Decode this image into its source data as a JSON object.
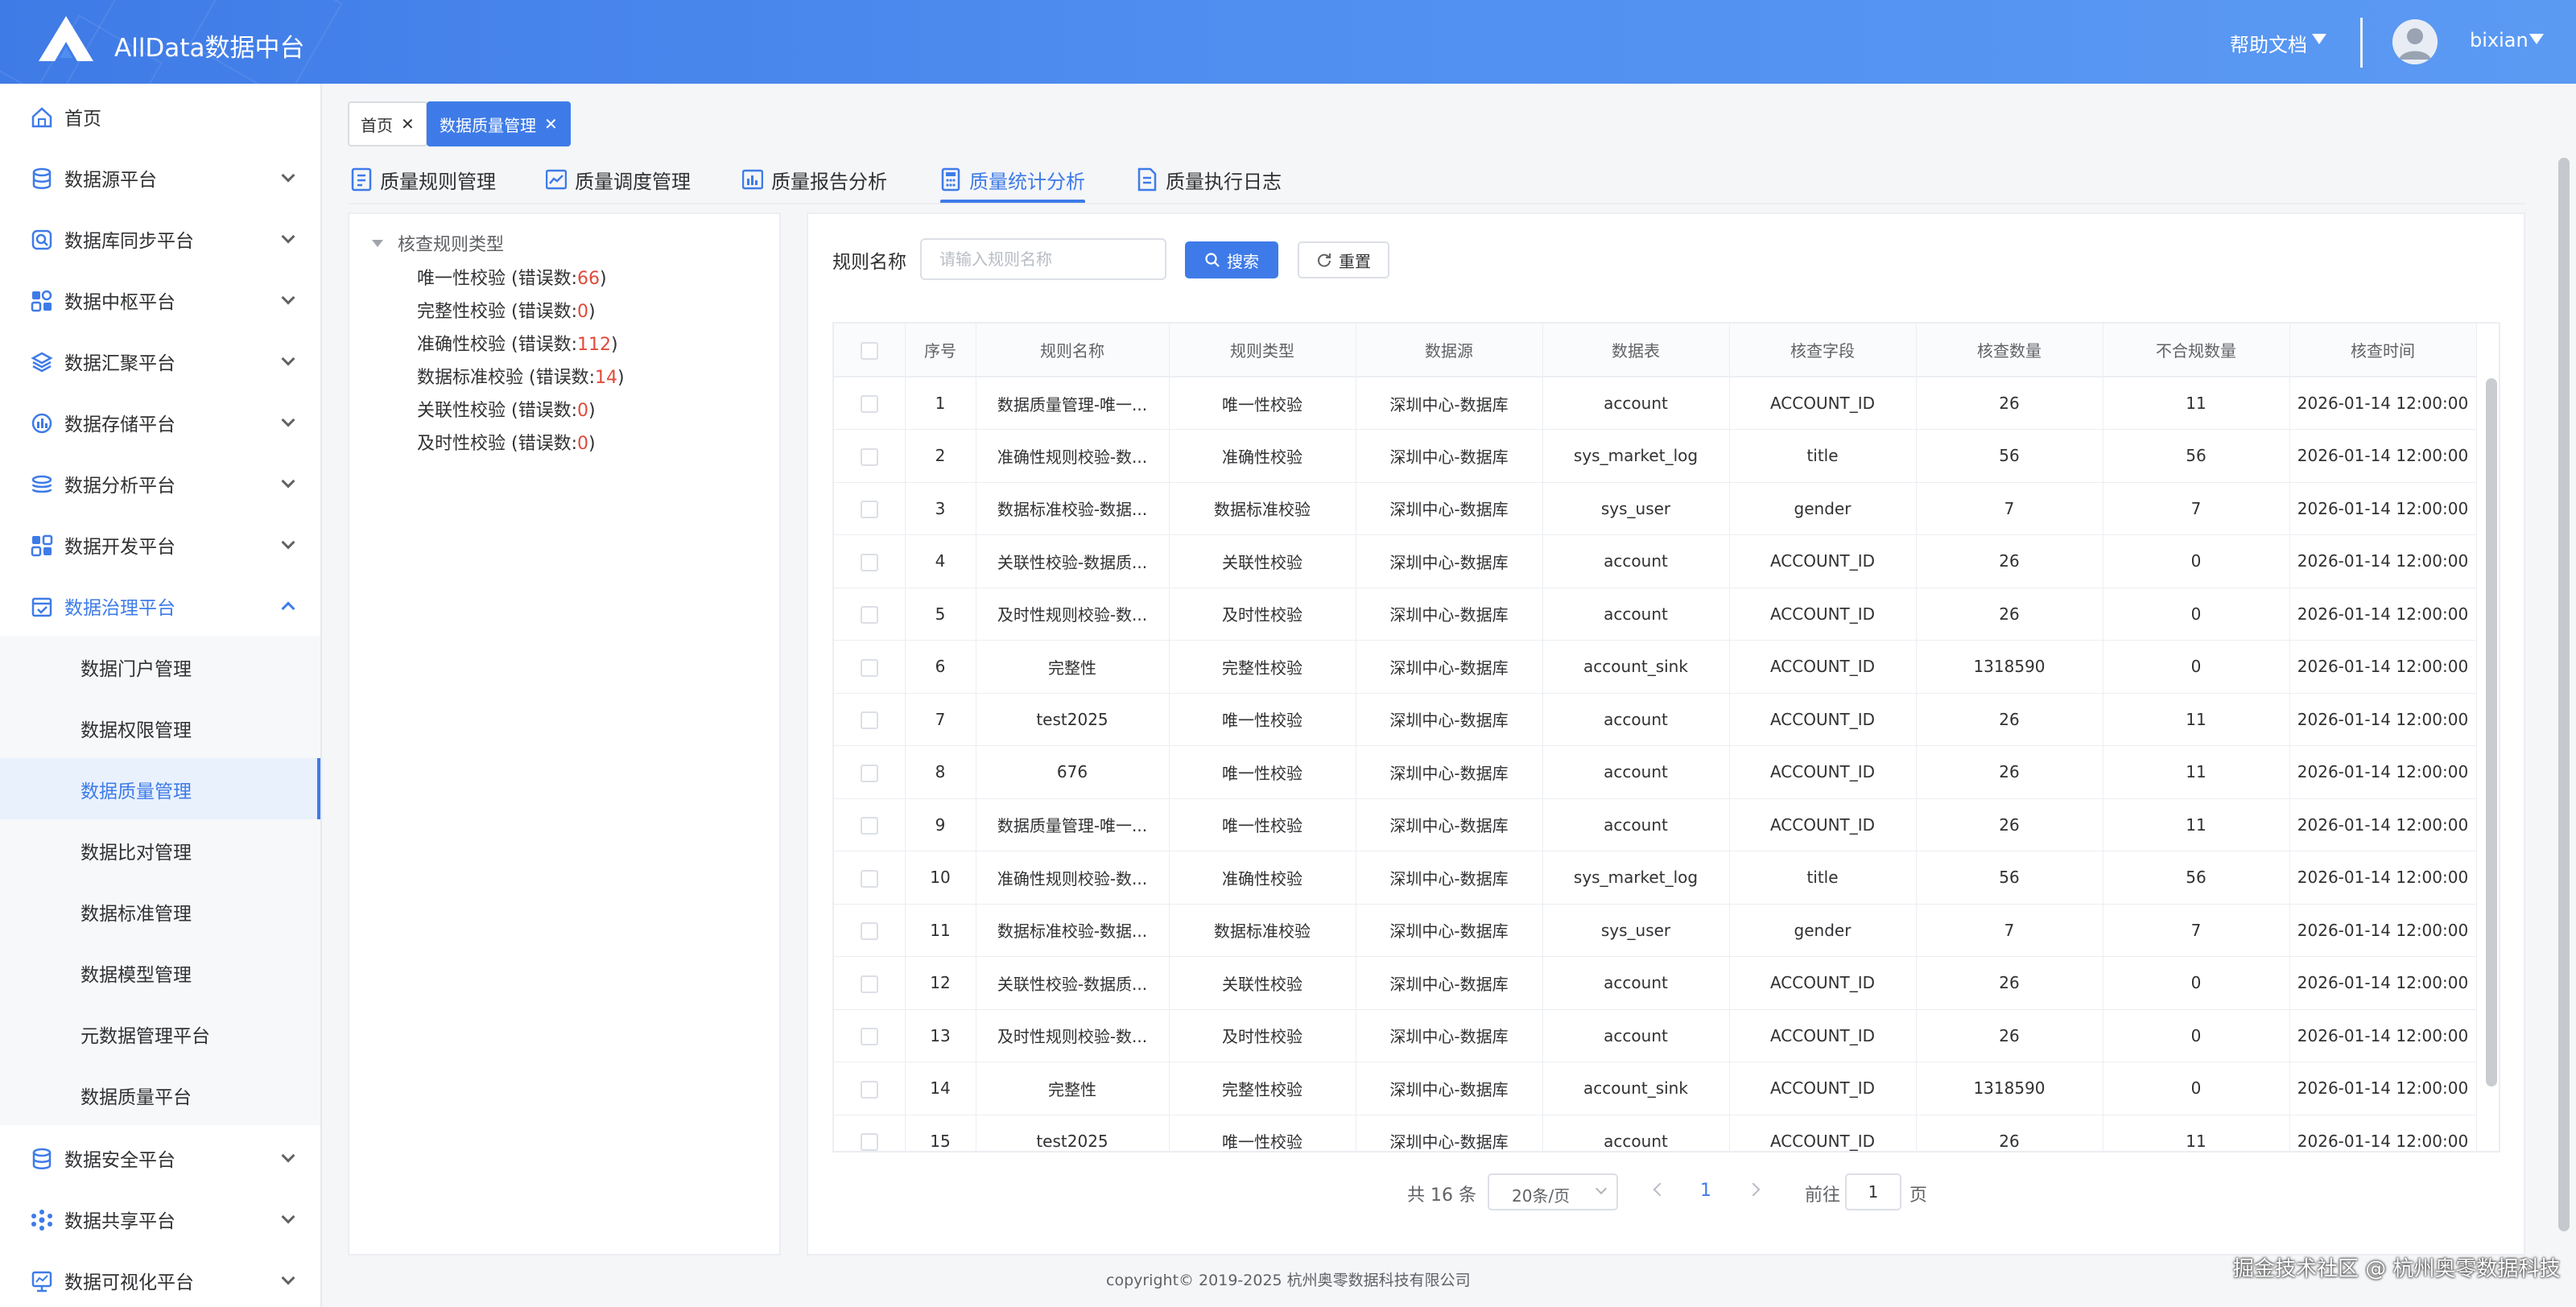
{
  "app": {
    "title": "AllData数据中台"
  },
  "header": {
    "help_label": "帮助文档",
    "username": "bixian"
  },
  "sidebar": {
    "items": [
      {
        "label": "首页",
        "icon": "home-icon",
        "expandable": false
      },
      {
        "label": "数据源平台",
        "icon": "database-icon",
        "expandable": true
      },
      {
        "label": "数据库同步平台",
        "icon": "sync-icon",
        "expandable": true
      },
      {
        "label": "数据中枢平台",
        "icon": "hub-icon",
        "expandable": true
      },
      {
        "label": "数据汇聚平台",
        "icon": "layers-icon",
        "expandable": true
      },
      {
        "label": "数据存储平台",
        "icon": "storage-icon",
        "expandable": true
      },
      {
        "label": "数据分析平台",
        "icon": "analysis-icon",
        "expandable": true
      },
      {
        "label": "数据开发平台",
        "icon": "dev-icon",
        "expandable": true
      },
      {
        "label": "数据治理平台",
        "icon": "governance-icon",
        "expandable": true,
        "expanded": true
      },
      {
        "label": "数据安全平台",
        "icon": "security-icon",
        "expandable": true
      },
      {
        "label": "数据共享平台",
        "icon": "share-icon",
        "expandable": true
      },
      {
        "label": "数据可视化平台",
        "icon": "chart-icon",
        "expandable": true
      }
    ],
    "submenu": [
      {
        "label": "数据门户管理"
      },
      {
        "label": "数据权限管理"
      },
      {
        "label": "数据质量管理",
        "selected": true
      },
      {
        "label": "数据比对管理"
      },
      {
        "label": "数据标准管理"
      },
      {
        "label": "数据模型管理"
      },
      {
        "label": "元数据管理平台"
      },
      {
        "label": "数据质量平台"
      }
    ]
  },
  "tags": [
    {
      "label": "首页",
      "active": false
    },
    {
      "label": "数据质量管理",
      "active": true
    }
  ],
  "subtabs": [
    {
      "label": "质量规则管理"
    },
    {
      "label": "质量调度管理"
    },
    {
      "label": "质量报告分析"
    },
    {
      "label": "质量统计分析",
      "active": true
    },
    {
      "label": "质量执行日志"
    }
  ],
  "tree": {
    "root": "核查规则类型",
    "nodes": [
      {
        "name": "唯一性校验",
        "prefix": " (错误数:",
        "count": "66",
        "suffix": ")"
      },
      {
        "name": "完整性校验",
        "prefix": " (错误数:",
        "count": "0",
        "suffix": ")"
      },
      {
        "name": "准确性校验",
        "prefix": " (错误数:",
        "count": "112",
        "suffix": ")"
      },
      {
        "name": "数据标准校验",
        "prefix": " (错误数:",
        "count": "14",
        "suffix": ")"
      },
      {
        "name": "关联性校验",
        "prefix": " (错误数:",
        "count": "0",
        "suffix": ")"
      },
      {
        "name": "及时性校验",
        "prefix": " (错误数:",
        "count": "0",
        "suffix": ")"
      }
    ]
  },
  "search": {
    "label": "规则名称",
    "placeholder": "请输入规则名称",
    "search_button": "搜索",
    "reset_button": "重置"
  },
  "table": {
    "headers": [
      "序号",
      "规则名称",
      "规则类型",
      "数据源",
      "数据表",
      "核查字段",
      "核查数量",
      "不合规数量",
      "核查时间"
    ],
    "rows": [
      [
        "1",
        "数据质量管理-唯一...",
        "唯一性校验",
        "深圳中心-数据库",
        "account",
        "ACCOUNT_ID",
        "26",
        "11",
        "2026-01-14 12:00:00"
      ],
      [
        "2",
        "准确性规则校验-数...",
        "准确性校验",
        "深圳中心-数据库",
        "sys_market_log",
        "title",
        "56",
        "56",
        "2026-01-14 12:00:00"
      ],
      [
        "3",
        "数据标准校验-数据...",
        "数据标准校验",
        "深圳中心-数据库",
        "sys_user",
        "gender",
        "7",
        "7",
        "2026-01-14 12:00:00"
      ],
      [
        "4",
        "关联性校验-数据质...",
        "关联性校验",
        "深圳中心-数据库",
        "account",
        "ACCOUNT_ID",
        "26",
        "0",
        "2026-01-14 12:00:00"
      ],
      [
        "5",
        "及时性规则校验-数...",
        "及时性校验",
        "深圳中心-数据库",
        "account",
        "ACCOUNT_ID",
        "26",
        "0",
        "2026-01-14 12:00:00"
      ],
      [
        "6",
        "完整性",
        "完整性校验",
        "深圳中心-数据库",
        "account_sink",
        "ACCOUNT_ID",
        "1318590",
        "0",
        "2026-01-14 12:00:00"
      ],
      [
        "7",
        "test2025",
        "唯一性校验",
        "深圳中心-数据库",
        "account",
        "ACCOUNT_ID",
        "26",
        "11",
        "2026-01-14 12:00:00"
      ],
      [
        "8",
        "676",
        "唯一性校验",
        "深圳中心-数据库",
        "account",
        "ACCOUNT_ID",
        "26",
        "11",
        "2026-01-14 12:00:00"
      ],
      [
        "9",
        "数据质量管理-唯一...",
        "唯一性校验",
        "深圳中心-数据库",
        "account",
        "ACCOUNT_ID",
        "26",
        "11",
        "2026-01-14 12:00:00"
      ],
      [
        "10",
        "准确性规则校验-数...",
        "准确性校验",
        "深圳中心-数据库",
        "sys_market_log",
        "title",
        "56",
        "56",
        "2026-01-14 12:00:00"
      ],
      [
        "11",
        "数据标准校验-数据...",
        "数据标准校验",
        "深圳中心-数据库",
        "sys_user",
        "gender",
        "7",
        "7",
        "2026-01-14 12:00:00"
      ],
      [
        "12",
        "关联性校验-数据质...",
        "关联性校验",
        "深圳中心-数据库",
        "account",
        "ACCOUNT_ID",
        "26",
        "0",
        "2026-01-14 12:00:00"
      ],
      [
        "13",
        "及时性规则校验-数...",
        "及时性校验",
        "深圳中心-数据库",
        "account",
        "ACCOUNT_ID",
        "26",
        "0",
        "2026-01-14 12:00:00"
      ],
      [
        "14",
        "完整性",
        "完整性校验",
        "深圳中心-数据库",
        "account_sink",
        "ACCOUNT_ID",
        "1318590",
        "0",
        "2026-01-14 12:00:00"
      ],
      [
        "15",
        "test2025",
        "唯一性校验",
        "深圳中心-数据库",
        "account",
        "ACCOUNT_ID",
        "26",
        "11",
        "2026-01-14 12:00:00"
      ]
    ]
  },
  "pagination": {
    "total_label": "共 16 条",
    "page_size": "20条/页",
    "current_page": "1",
    "goto_label": "前往",
    "goto_value": "1",
    "page_suffix": "页"
  },
  "footer": {
    "copyright": "copyright© 2019-2025 杭州奥零数据科技有限公司",
    "watermark": "掘金技术社区 @ 杭州奥零数据科技"
  },
  "colors": {
    "accent": "#3e7be8",
    "header": "#4f8df0",
    "error_count": "#e04a3a"
  }
}
